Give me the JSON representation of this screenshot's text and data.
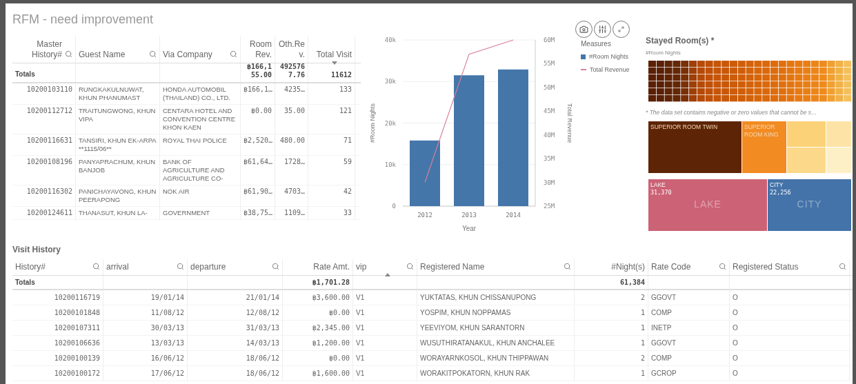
{
  "title": "RFM - need improvement",
  "guest_table": {
    "totals_label": "Totals",
    "columns": [
      {
        "label": "Master History#",
        "kind": "number",
        "search": true,
        "sorted": false
      },
      {
        "label": "Guest Name",
        "kind": "text",
        "search": true,
        "sorted": false
      },
      {
        "label": "Via Company",
        "kind": "text",
        "search": true,
        "sorted": false
      },
      {
        "label": "Room Rev.",
        "kind": "number",
        "search": false,
        "sorted": false,
        "total": "฿166,155.00"
      },
      {
        "label": "Oth.Rev.",
        "kind": "number",
        "search": false,
        "sorted": false,
        "total": "4925767.76"
      },
      {
        "label": "Total Visit",
        "kind": "number",
        "search": false,
        "sorted": true,
        "descending": true,
        "total": "11612"
      }
    ],
    "rows": [
      [
        "10200103110",
        "RUNGKAKULNUWAT, KHUN PHANUMAST",
        "HONDA AUTOMOBIL (THAILAND) CO., LTD.",
        "฿166,1…",
        "4235…",
        "133"
      ],
      [
        "10200112712",
        "TRAITUNGWONG, KHUN VIPA",
        "CENTARA HOTEL AND CONVENTION CENTRE KHON KAEN",
        "฿0.00",
        "35.00",
        "121"
      ],
      [
        "10200116631",
        "TANSIRI, KHUN EK-ARPA **1115/06**",
        "ROYAL THAI POLICE",
        "฿2,520…",
        "480.00",
        "71"
      ],
      [
        "10200108196",
        "PANYAPRACHUM, KHUN BANJOB",
        "BANK OF AGRICULTURE AND AGRICULTURE CO-",
        "฿61,64…",
        "1728…",
        "59"
      ],
      [
        "10200116302",
        "PANICHAYAVONG, KHUN PEERAPONG",
        "NOK AIR",
        "฿61,90…",
        "4703…",
        "42"
      ],
      [
        "10200124611",
        "THANASUT, KHUN LA-",
        "GOVERNMENT",
        "฿38,75…",
        "1109…",
        "33"
      ]
    ]
  },
  "chart": {
    "legend_title": "Measures",
    "chart_data": {
      "type": "bar",
      "xlabel": "Year",
      "ylabel": "#Room Nights",
      "categories": [
        "2012",
        "2013",
        "2014"
      ],
      "series": [
        {
          "name": "#Room Nights",
          "color": "#4476a9",
          "values": [
            15800,
            31500,
            32900
          ]
        }
      ],
      "ylim": [
        0,
        40000
      ],
      "grid": true,
      "yticks": [
        {
          "value": 40000,
          "label": "40k"
        },
        {
          "value": 30000,
          "label": "30k"
        },
        {
          "value": 20000,
          "label": "20k"
        },
        {
          "value": 10000,
          "label": "10k"
        },
        {
          "value": 0,
          "label": "0"
        }
      ]
    },
    "revenue_overlay": {
      "chart_data": {
        "type": "line",
        "ylabel": "Total Revenue",
        "series": [
          {
            "name": "Total Revenue",
            "color": "#d8809a",
            "values": [
              30000000,
              57000000,
              60000000
            ]
          }
        ],
        "ylim": [
          25000000,
          60000000
        ],
        "yticks": [
          {
            "value": 60000000,
            "label": "60M"
          },
          {
            "value": 55000000,
            "label": "55M"
          },
          {
            "value": 50000000,
            "label": "50M"
          },
          {
            "value": 45000000,
            "label": "45M"
          },
          {
            "value": 40000000,
            "label": "40M"
          },
          {
            "value": 35000000,
            "label": "35M"
          },
          {
            "value": 30000000,
            "label": "30M"
          },
          {
            "value": 25000000,
            "label": "25M"
          }
        ]
      }
    }
  },
  "treemap": {
    "title": "Stayed Room(s) *",
    "subtitle": "#Room Nights",
    "note": "* The data set contains negative or zero values that cannot be s…",
    "room_types": [
      {
        "label": "SUPERIOR ROOM TWIN",
        "color": "#5e2406"
      },
      {
        "label": "SUPERIOR ROOM KING",
        "color": "#f28b22"
      }
    ],
    "zones": [
      {
        "label": "LAKE",
        "value": "31,370",
        "watermark": "LAKE",
        "color": "#cc6275"
      },
      {
        "label": "CITY",
        "value": "22,256",
        "watermark": "CITY",
        "color": "#4473a9"
      }
    ]
  },
  "visit_history": {
    "title": "Visit History",
    "totals_label": "Totals",
    "columns": [
      {
        "label": "History#",
        "kind": "number",
        "search": true,
        "sorted": false
      },
      {
        "label": "arrival",
        "kind": "number",
        "search": true,
        "sorted": false
      },
      {
        "label": "departure",
        "kind": "number",
        "search": true,
        "sorted": false
      },
      {
        "label": "Rate Amt.",
        "kind": "number",
        "search": false,
        "sorted": false,
        "total": "฿1,701.28"
      },
      {
        "label": "vip",
        "kind": "text",
        "search": true,
        "sorted": true,
        "descending": false
      },
      {
        "label": "Registered Name",
        "kind": "text",
        "search": true,
        "sorted": false
      },
      {
        "label": "#Night(s)",
        "kind": "number",
        "search": false,
        "sorted": false,
        "total": "61,384"
      },
      {
        "label": "Rate Code",
        "kind": "text",
        "search": true,
        "sorted": false
      },
      {
        "label": "Registered Status",
        "kind": "text",
        "search": true,
        "sorted": false
      }
    ],
    "rows": [
      [
        "10200116719",
        "19/01/14",
        "21/01/14",
        "฿3,600.00",
        "V1",
        "YUKTATAS, KHUN CHISSANUPONG",
        "2",
        "GGOVT",
        "O"
      ],
      [
        "10200101848",
        "11/08/12",
        "12/08/12",
        "฿0.00",
        "V1",
        "YOSPIM, KHUN NOPPAMAS",
        "1",
        "COMP",
        "O"
      ],
      [
        "10200107311",
        "30/03/13",
        "31/03/13",
        "฿2,345.00",
        "V1",
        "YEEVIYOM, KHUN SARANTORN",
        "1",
        "INETP",
        "O"
      ],
      [
        "10200106636",
        "13/03/13",
        "14/03/13",
        "฿1,200.00",
        "V1",
        "WUSUTHIRATANAKUL, KHUN ANCHALEE",
        "1",
        "GGOVT",
        "O"
      ],
      [
        "10200100139",
        "16/06/12",
        "18/06/12",
        "฿0.00",
        "V1",
        "WORAYARNKOSOL, KHUN THIPPAWAN",
        "2",
        "COMP",
        "O"
      ],
      [
        "10200100172",
        "17/06/12",
        "18/06/12",
        "฿1,600.00",
        "V1",
        "WORAKITPOKATORN, KHUN RAK",
        "1",
        "GCROP",
        "O"
      ]
    ]
  }
}
